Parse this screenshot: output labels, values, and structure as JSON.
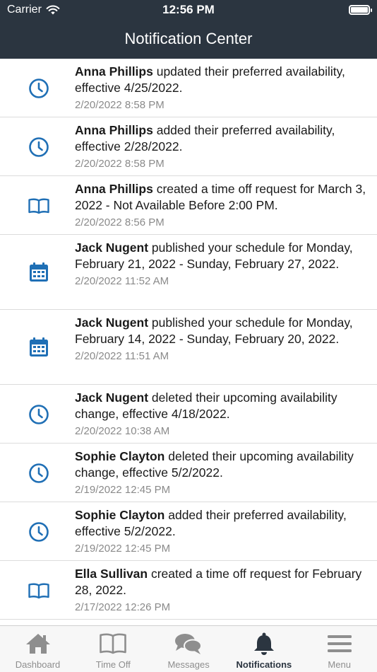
{
  "status_bar": {
    "carrier": "Carrier",
    "time": "12:56 PM"
  },
  "header": {
    "title": "Notification Center"
  },
  "notifications": [
    {
      "icon": "clock-icon",
      "name": "Anna Phillips",
      "text": " updated their preferred availability, effective 4/25/2022.",
      "timestamp": "2/20/2022 8:58 PM"
    },
    {
      "icon": "clock-icon",
      "name": "Anna Phillips",
      "text": " added their preferred availability, effective 2/28/2022.",
      "timestamp": "2/20/2022 8:58 PM"
    },
    {
      "icon": "book-icon",
      "name": "Anna Phillips",
      "text": " created a time off request for March 3, 2022 - Not Available Before 2:00 PM.",
      "timestamp": "2/20/2022 8:56 PM"
    },
    {
      "icon": "calendar-icon",
      "name": "Jack Nugent",
      "text": " published your schedule for Monday, February 21, 2022 - Sunday, February 27, 2022.",
      "timestamp": "2/20/2022 11:52 AM"
    },
    {
      "icon": "calendar-icon",
      "name": "Jack Nugent",
      "text": " published your schedule for Monday, February 14, 2022 - Sunday, February 20, 2022.",
      "timestamp": "2/20/2022 11:51 AM"
    },
    {
      "icon": "clock-icon",
      "name": "Jack Nugent",
      "text": " deleted their upcoming availability change, effective 4/18/2022.",
      "timestamp": "2/20/2022 10:38 AM"
    },
    {
      "icon": "clock-icon",
      "name": "Sophie Clayton",
      "text": " deleted their upcoming availability change, effective 5/2/2022.",
      "timestamp": "2/19/2022 12:45 PM"
    },
    {
      "icon": "clock-icon",
      "name": "Sophie Clayton",
      "text": " added their preferred availability, effective 5/2/2022.",
      "timestamp": "2/19/2022 12:45 PM"
    },
    {
      "icon": "book-icon",
      "name": "Ella Sullivan",
      "text": " created a time off request for February 28, 2022.",
      "timestamp": "2/17/2022 12:26 PM"
    }
  ],
  "tabs": [
    {
      "label": "Dashboard",
      "icon": "house-icon",
      "active": false
    },
    {
      "label": "Time Off",
      "icon": "book-icon",
      "active": false
    },
    {
      "label": "Messages",
      "icon": "chat-bubbles-icon",
      "active": false
    },
    {
      "label": "Notifications",
      "icon": "bell-icon",
      "active": true
    },
    {
      "label": "Menu",
      "icon": "hamburger-menu-icon",
      "active": false
    }
  ],
  "colors": {
    "header_bg": "#2b3540",
    "icon_blue": "#1f6fb5",
    "tab_inactive": "#8e8e8e",
    "tab_active": "#2b3540"
  }
}
